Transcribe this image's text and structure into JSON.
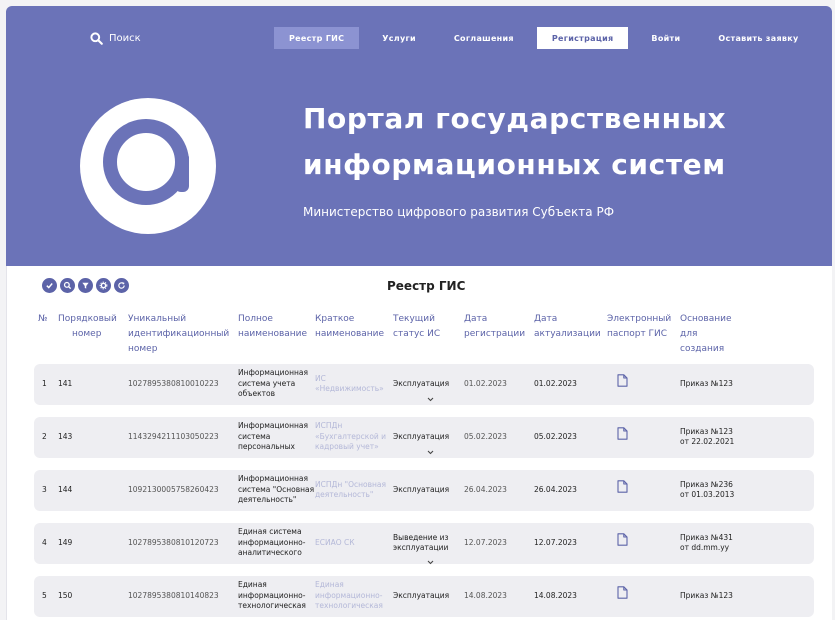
{
  "header": {
    "search_label": "Поиск",
    "nav": [
      {
        "label": "Реестр ГИС",
        "state": "active"
      },
      {
        "label": "Услуги",
        "state": "normal"
      },
      {
        "label": "Соглашения",
        "state": "normal"
      },
      {
        "label": "Регистрация",
        "state": "highlight"
      },
      {
        "label": "Войти",
        "state": "normal"
      },
      {
        "label": "Оставить заявку",
        "state": "normal"
      }
    ]
  },
  "hero": {
    "title_line1": "Портал государственных",
    "title_line2": "информационных систем",
    "subtitle": "Министерство цифрового развития Субъекта РФ"
  },
  "registry": {
    "title": "Реестр ГИС",
    "toolbar_icons": [
      "check-icon",
      "search-icon",
      "filter-icon",
      "settings-icon",
      "refresh-icon"
    ],
    "columns": {
      "num": "№",
      "order_1": "Порядковый",
      "order_2": "номер",
      "uid_1": "Уникальный",
      "uid_2": "идентификационный",
      "uid_3": "номер",
      "full_1": "Полное",
      "full_2": "наименование",
      "short_1": "Краткое",
      "short_2": "наименование",
      "status_1": "Текущий",
      "status_2": "статус ИС",
      "reg_1": "Дата",
      "reg_2": "регистрации",
      "upd_1": "Дата",
      "upd_2": "актуализации",
      "pass_1": "Электронный",
      "pass_2": "паспорт ГИС",
      "basis_1": "Основание",
      "basis_2": "для",
      "basis_3": "создания"
    },
    "rows": [
      {
        "n": "1",
        "order": "141",
        "uid": "1027895380810010223",
        "full": [
          "Информационная",
          "система учета",
          "объектов"
        ],
        "short": [
          "ИС",
          "«Недвижимость»"
        ],
        "status": [
          "Эксплуатация"
        ],
        "has_dropdown": true,
        "reg_date": "01.02.2023",
        "upd_date": "01.02.2023",
        "basis": [
          "Приказ №123"
        ]
      },
      {
        "n": "2",
        "order": "143",
        "uid": "1143294211103050223",
        "full": [
          "Информационная",
          "система",
          "персональных"
        ],
        "short": [
          "ИСПДн",
          "«Бухгалтерской и",
          "кадровый учет»"
        ],
        "status": [
          "Эксплуатация"
        ],
        "has_dropdown": true,
        "reg_date": "05.02.2023",
        "upd_date": "05.02.2023",
        "basis": [
          "Приказ №123",
          "от 22.02.2021"
        ]
      },
      {
        "n": "3",
        "order": "144",
        "uid": "1092130005758260423",
        "full": [
          "Информационная",
          "система \"Основная",
          "деятельность\""
        ],
        "short": [
          "ИСПДн \"Основная",
          "деятельность\""
        ],
        "status": [
          "Эксплуатация"
        ],
        "has_dropdown": false,
        "reg_date": "26.04.2023",
        "upd_date": "26.04.2023",
        "basis": [
          "Приказ №236",
          "от 01.03.2013"
        ]
      },
      {
        "n": "4",
        "order": "149",
        "uid": "1027895380810120723",
        "full": [
          "Единая система",
          "информационно-",
          "аналитического"
        ],
        "short": [
          "ЕСИАО СК"
        ],
        "status": [
          "Выведение из",
          "эксплуатации"
        ],
        "has_dropdown": true,
        "reg_date": "12.07.2023",
        "upd_date": "12.07.2023",
        "basis": [
          "Приказ №431",
          "от dd.mm.yy"
        ]
      },
      {
        "n": "5",
        "order": "150",
        "uid": "1027895380810140823",
        "full": [
          "Единая",
          "информационно-",
          "технологическая"
        ],
        "short": [
          "Единая",
          "информационно-",
          "технологическая"
        ],
        "status": [
          "Эксплуатация"
        ],
        "has_dropdown": false,
        "reg_date": "14.08.2023",
        "upd_date": "14.08.2023",
        "basis": [
          "Приказ №123"
        ]
      }
    ]
  },
  "colors": {
    "brand": "#6b73b8",
    "brand_dark": "#5c63a8",
    "row_bg": "#eeeef2"
  }
}
